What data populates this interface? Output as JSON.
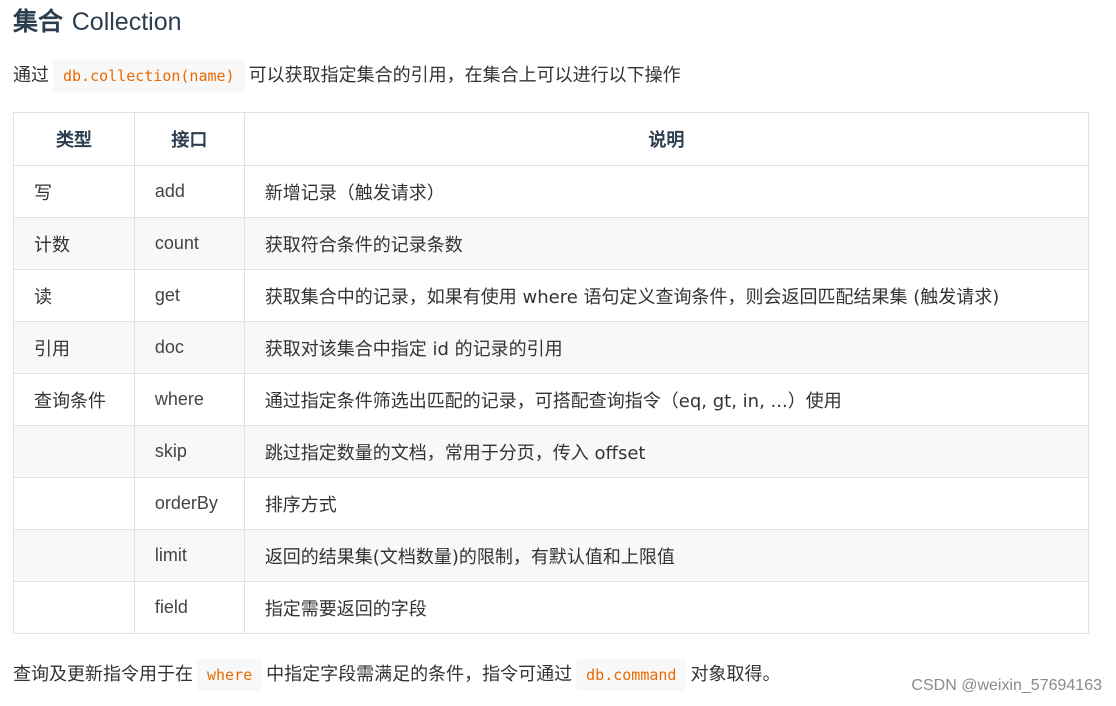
{
  "heading": {
    "zh": "集合",
    "en": "Collection"
  },
  "intro": {
    "prefix": "通过",
    "code": "db.collection(name)",
    "suffix": "可以获取指定集合的引用，在集合上可以进行以下操作"
  },
  "table": {
    "headers": [
      "类型",
      "接口",
      "说明"
    ],
    "rows": [
      {
        "type": "写",
        "api": "add",
        "desc": "新增记录（触发请求）"
      },
      {
        "type": "计数",
        "api": "count",
        "desc": "获取符合条件的记录条数"
      },
      {
        "type": "读",
        "api": "get",
        "desc": "获取集合中的记录，如果有使用 where 语句定义查询条件，则会返回匹配结果集 (触发请求)"
      },
      {
        "type": "引用",
        "api": "doc",
        "desc": "获取对该集合中指定 id 的记录的引用"
      },
      {
        "type": "查询条件",
        "api": "where",
        "desc": "通过指定条件筛选出匹配的记录，可搭配查询指令（eq, gt, in, ...）使用"
      },
      {
        "type": "",
        "api": "skip",
        "desc": "跳过指定数量的文档，常用于分页，传入 offset"
      },
      {
        "type": "",
        "api": "orderBy",
        "desc": "排序方式"
      },
      {
        "type": "",
        "api": "limit",
        "desc": "返回的结果集(文档数量)的限制，有默认值和上限值"
      },
      {
        "type": "",
        "api": "field",
        "desc": "指定需要返回的字段"
      }
    ]
  },
  "outro": {
    "prefix": "查询及更新指令用于在",
    "code1": "where",
    "middle": "中指定字段需满足的条件，指令可通过",
    "code2": "db.command",
    "suffix": "对象取得。"
  },
  "watermark": "CSDN @weixin_57694163"
}
